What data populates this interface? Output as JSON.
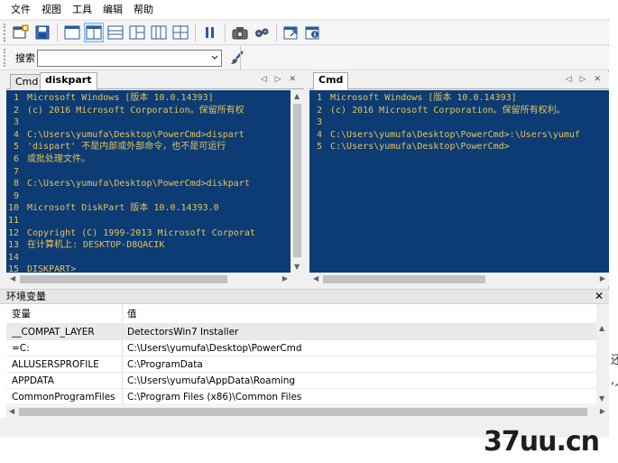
{
  "menu": [
    "文件",
    "视图",
    "工具",
    "编辑",
    "帮助"
  ],
  "toolbar_icons": [
    "new-console-icon",
    "save-icon",
    "layout-single-icon",
    "layout-vsplit-icon",
    "layout-hsplit-icon",
    "layout-three-icon",
    "layout-four-icon",
    "layout-grid-icon",
    "pause-icon",
    "screenshot-icon",
    "settings-icon",
    "export-icon",
    "about-icon"
  ],
  "search": {
    "label": "搜索",
    "value": ""
  },
  "left_pane": {
    "tabs": [
      "Cmd",
      "diskpart"
    ],
    "active_tab": "diskpart",
    "lines": [
      {
        "n": "1",
        "t": "Microsoft Windows [版本 10.0.14393]"
      },
      {
        "n": "2",
        "t": "(c) 2016 Microsoft Corporation。保留所有权"
      },
      {
        "n": "3",
        "t": ""
      },
      {
        "n": "4",
        "t": "C:\\Users\\yumufa\\Desktop\\PowerCmd>dispart"
      },
      {
        "n": "5",
        "t": "'dispart' 不是内部或外部命令，也不是可运行"
      },
      {
        "n": "6",
        "t": "或批处理文件。"
      },
      {
        "n": "7",
        "t": ""
      },
      {
        "n": "8",
        "t": "C:\\Users\\yumufa\\Desktop\\PowerCmd>diskpart"
      },
      {
        "n": "9",
        "t": ""
      },
      {
        "n": "10",
        "t": "Microsoft DiskPart 版本 10.0.14393.0"
      },
      {
        "n": "11",
        "t": ""
      },
      {
        "n": "12",
        "t": "Copyright (C) 1999-2013 Microsoft Corporat"
      },
      {
        "n": "13",
        "t": "在计算机上: DESKTOP-D8QACIK"
      },
      {
        "n": "14",
        "t": ""
      },
      {
        "n": "15",
        "t": "DISKPART>"
      }
    ]
  },
  "right_pane": {
    "tabs": [
      "Cmd"
    ],
    "active_tab": "Cmd",
    "lines": [
      {
        "n": "1",
        "t": "Microsoft Windows [版本 10.0.14393]"
      },
      {
        "n": "2",
        "t": "(c) 2016 Microsoft Corporation。保留所有权利。"
      },
      {
        "n": "3",
        "t": ""
      },
      {
        "n": "4",
        "t": "C:\\Users\\yumufa\\Desktop\\PowerCmd>:\\Users\\yumuf"
      },
      {
        "n": "5",
        "t": "C:\\Users\\yumufa\\Desktop\\PowerCmd>"
      }
    ]
  },
  "env": {
    "title": "环境变量",
    "headers": [
      "变量",
      "值"
    ],
    "rows": [
      [
        "__COMPAT_LAYER",
        "DetectorsWin7 Installer"
      ],
      [
        "=C:",
        "C:\\Users\\yumufa\\Desktop\\PowerCmd"
      ],
      [
        "ALLUSERSPROFILE",
        "C:\\ProgramData"
      ],
      [
        "APPDATA",
        "C:\\Users\\yumufa\\AppData\\Roaming"
      ],
      [
        "CommonProgramFiles",
        "C:\\Program Files (x86)\\Common Files"
      ]
    ]
  },
  "watermark": "37uu.cn",
  "edge_glyphs": [
    "还",
    "‘个"
  ],
  "colors": {
    "console_bg": "#0c3c73",
    "console_fg": "#e8c25a",
    "accent": "#7eb4ea"
  }
}
